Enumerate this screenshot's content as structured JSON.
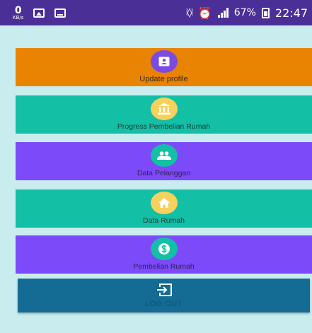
{
  "status_bar": {
    "net_speed_value": "0",
    "net_speed_unit": "KB/s",
    "battery_percent": "67%",
    "time": "22:47"
  },
  "menu": [
    {
      "label": "Update profile",
      "icon": "profile-card-icon",
      "color": "#e98302",
      "badge_color": "#7b4ae2"
    },
    {
      "label": "Progress Pembelian Rumah",
      "icon": "bank-icon",
      "color": "#13bfa5",
      "badge_color": "#f6d15e"
    },
    {
      "label": "Data Pelanggan",
      "icon": "people-icon",
      "color": "#7c4af8",
      "badge_color": "#13bfa5"
    },
    {
      "label": "Data Rumah",
      "icon": "home-icon",
      "color": "#13bfa5",
      "badge_color": "#f6d15e"
    },
    {
      "label": "Pembelian Rumah",
      "icon": "dollar-icon",
      "color": "#7c4af8",
      "badge_color": "#13bfa5"
    }
  ],
  "logout": {
    "label": "LOG OUT",
    "icon": "logout-icon",
    "color": "#146b93"
  },
  "colors": {
    "background": "#c9edee",
    "status_bar": "#4a2f96"
  }
}
